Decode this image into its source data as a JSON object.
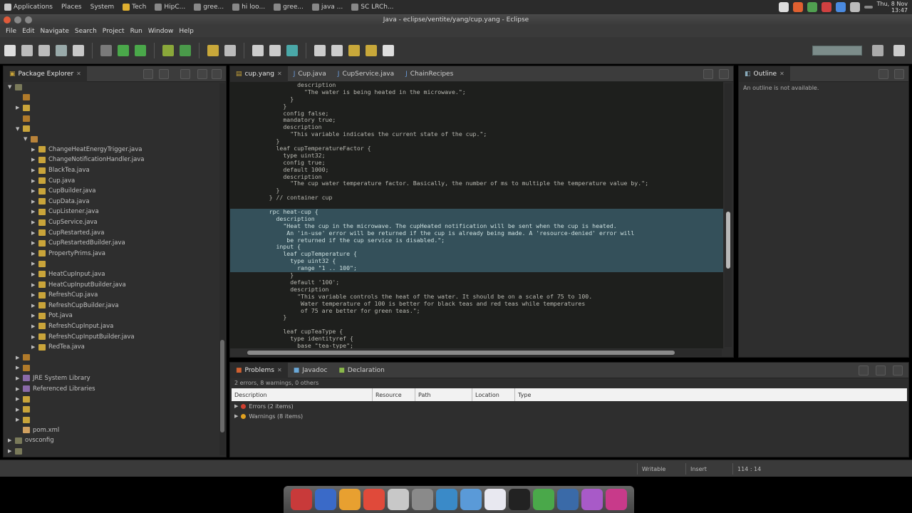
{
  "topbar": {
    "items": [
      {
        "label": "Applications",
        "icon": "app-menu-icon"
      },
      {
        "label": "Places",
        "icon": ""
      },
      {
        "label": "System",
        "icon": ""
      },
      {
        "label": "Tech",
        "icon": "browser-icon"
      },
      {
        "label": "HipC...",
        "icon": "window-icon"
      },
      {
        "label": "gree...",
        "icon": "window-icon"
      },
      {
        "label": "hi loo...",
        "icon": "window-icon"
      },
      {
        "label": "gree...",
        "icon": "window-icon"
      },
      {
        "label": "java ...",
        "icon": "window-icon"
      },
      {
        "label": "SC LRCh...",
        "icon": "window-icon"
      }
    ],
    "clock_day": "Thu, 8 Nov",
    "clock_time": "13:47"
  },
  "window": {
    "title": "Java - eclipse/ventite/yang/cup.yang - Eclipse"
  },
  "menu": [
    "File",
    "Edit",
    "Navigate",
    "Search",
    "Project",
    "Run",
    "Window",
    "Help"
  ],
  "package_explorer": {
    "tab_label": "Package Explorer",
    "rows": [
      {
        "indent": 0,
        "arrow": "▼",
        "label": "",
        "color": "#7a7a5a"
      },
      {
        "indent": 1,
        "arrow": "",
        "label": "",
        "color": "#b07a2a"
      },
      {
        "indent": 1,
        "arrow": "▶",
        "label": "",
        "color": "#c9a43a"
      },
      {
        "indent": 1,
        "arrow": "",
        "label": "",
        "color": "#b07a2a"
      },
      {
        "indent": 1,
        "arrow": "▼",
        "label": "",
        "color": "#c9a43a"
      },
      {
        "indent": 2,
        "arrow": "▼",
        "label": "",
        "color": "#b9833a"
      },
      {
        "indent": 3,
        "arrow": "▶",
        "label": "ChangeHeatEnergyTrigger.java",
        "color": "#c9a43a"
      },
      {
        "indent": 3,
        "arrow": "▶",
        "label": "ChangeNotificationHandler.java",
        "color": "#c9a43a"
      },
      {
        "indent": 3,
        "arrow": "▶",
        "label": "BlackTea.java",
        "color": "#c9a43a"
      },
      {
        "indent": 3,
        "arrow": "▶",
        "label": "Cup.java",
        "color": "#c9a43a"
      },
      {
        "indent": 3,
        "arrow": "▶",
        "label": "CupBuilder.java",
        "color": "#c9a43a"
      },
      {
        "indent": 3,
        "arrow": "▶",
        "label": "CupData.java",
        "color": "#c9a43a"
      },
      {
        "indent": 3,
        "arrow": "▶",
        "label": "CupListener.java",
        "color": "#c9a43a"
      },
      {
        "indent": 3,
        "arrow": "▶",
        "label": "CupService.java",
        "color": "#c9a43a"
      },
      {
        "indent": 3,
        "arrow": "▶",
        "label": "CupRestarted.java",
        "color": "#c9a43a"
      },
      {
        "indent": 3,
        "arrow": "▶",
        "label": "CupRestartedBuilder.java",
        "color": "#c9a43a"
      },
      {
        "indent": 3,
        "arrow": "▶",
        "label": "PropertyPrims.java",
        "color": "#c9a43a"
      },
      {
        "indent": 3,
        "arrow": "▶",
        "label": "",
        "color": "#c9a43a"
      },
      {
        "indent": 3,
        "arrow": "▶",
        "label": "HeatCupInput.java",
        "color": "#c9a43a"
      },
      {
        "indent": 3,
        "arrow": "▶",
        "label": "HeatCupInputBuilder.java",
        "color": "#c9a43a"
      },
      {
        "indent": 3,
        "arrow": "▶",
        "label": "RefreshCup.java",
        "color": "#c9a43a"
      },
      {
        "indent": 3,
        "arrow": "▶",
        "label": "RefreshCupBuilder.java",
        "color": "#c9a43a"
      },
      {
        "indent": 3,
        "arrow": "▶",
        "label": "Pot.java",
        "color": "#c9a43a"
      },
      {
        "indent": 3,
        "arrow": "▶",
        "label": "RefreshCupInput.java",
        "color": "#c9a43a"
      },
      {
        "indent": 3,
        "arrow": "▶",
        "label": "RefreshCupInputBuilder.java",
        "color": "#c9a43a"
      },
      {
        "indent": 3,
        "arrow": "▶",
        "label": "RedTea.java",
        "color": "#c9a43a"
      },
      {
        "indent": 1,
        "arrow": "▶",
        "label": "",
        "color": "#b07a2a"
      },
      {
        "indent": 1,
        "arrow": "▶",
        "label": "",
        "color": "#b07a2a"
      },
      {
        "indent": 1,
        "arrow": "▶",
        "label": "JRE System Library",
        "color": "#8a6aa8"
      },
      {
        "indent": 1,
        "arrow": "▶",
        "label": "Referenced Libraries",
        "color": "#8a6aa8"
      },
      {
        "indent": 1,
        "arrow": "▶",
        "label": "",
        "color": "#c9a43a"
      },
      {
        "indent": 1,
        "arrow": "▶",
        "label": "",
        "color": "#c9a43a"
      },
      {
        "indent": 1,
        "arrow": "▶",
        "label": "",
        "color": "#c9a43a"
      },
      {
        "indent": 1,
        "arrow": "",
        "label": "pom.xml",
        "color": "#d0a060"
      },
      {
        "indent": 0,
        "arrow": "▶",
        "label": "ovsconfig",
        "color": "#7a7a5a"
      },
      {
        "indent": 0,
        "arrow": "▶",
        "label": "",
        "color": "#7a7a5a"
      }
    ]
  },
  "editor": {
    "tabs": [
      {
        "label": "cup.yang",
        "active": true,
        "closable": true
      },
      {
        "label": "Cup.java",
        "active": false,
        "closable": false
      },
      {
        "label": "CupService.java",
        "active": false,
        "closable": false
      },
      {
        "label": "ChainRecipes",
        "active": false,
        "closable": false
      }
    ],
    "lines": [
      {
        "n": "",
        "text": "             description",
        "sel": false
      },
      {
        "n": "",
        "text": "               \"The water is being heated in the microwave.\";",
        "sel": false
      },
      {
        "n": "",
        "text": "           }",
        "sel": false
      },
      {
        "n": "",
        "text": "         }",
        "sel": false
      },
      {
        "n": "",
        "text": "         config false;",
        "sel": false
      },
      {
        "n": "",
        "text": "         mandatory true;",
        "sel": false
      },
      {
        "n": "",
        "text": "         description",
        "sel": false
      },
      {
        "n": "",
        "text": "           \"This variable indicates the current state of the cup.\";",
        "sel": false
      },
      {
        "n": "",
        "text": "       }",
        "sel": false
      },
      {
        "n": "",
        "text": "       leaf cupTemperatureFactor {",
        "sel": false
      },
      {
        "n": "",
        "text": "         type uint32;",
        "sel": false
      },
      {
        "n": "",
        "text": "         config true;",
        "sel": false
      },
      {
        "n": "",
        "text": "         default 1000;",
        "sel": false
      },
      {
        "n": "",
        "text": "         description",
        "sel": false
      },
      {
        "n": "",
        "text": "           \"The cup water temperature factor. Basically, the number of ms to multiple the temperature value by.\";",
        "sel": false
      },
      {
        "n": "",
        "text": "       }",
        "sel": false
      },
      {
        "n": "",
        "text": "     } // container cup",
        "sel": false
      },
      {
        "n": "",
        "text": "",
        "sel": false
      },
      {
        "n": "",
        "text": "     rpc heat-cup {",
        "sel": true
      },
      {
        "n": "",
        "text": "       description",
        "sel": true
      },
      {
        "n": "",
        "text": "         \"Heat the cup in the microwave. The cupHeated notification will be sent when the cup is heated.",
        "sel": true
      },
      {
        "n": "",
        "text": "          An 'in-use' error will be returned if the cup is already being made. A 'resource-denied' error will",
        "sel": true
      },
      {
        "n": "",
        "text": "          be returned if the cup service is disabled.\";",
        "sel": true
      },
      {
        "n": "",
        "text": "       input {",
        "sel": true
      },
      {
        "n": "",
        "text": "         leaf cupTemperature {",
        "sel": true
      },
      {
        "n": "",
        "text": "           type uint32 {",
        "sel": true
      },
      {
        "n": "",
        "text": "             range \"1 .. 100\";",
        "sel": true
      },
      {
        "n": "",
        "text": "           }",
        "sel": false
      },
      {
        "n": "",
        "text": "           default '100';",
        "sel": false
      },
      {
        "n": "",
        "text": "           description",
        "sel": false
      },
      {
        "n": "",
        "text": "             \"This variable controls the heat of the water. It should be on a scale of 75 to 100.",
        "sel": false
      },
      {
        "n": "",
        "text": "              Water temperature of 100 is better for black teas and red teas while temperatures",
        "sel": false
      },
      {
        "n": "",
        "text": "              of 75 are better for green teas.\";",
        "sel": false
      },
      {
        "n": "",
        "text": "         }",
        "sel": false
      },
      {
        "n": "",
        "text": "",
        "sel": false
      },
      {
        "n": "",
        "text": "         leaf cupTeaType {",
        "sel": false
      },
      {
        "n": "",
        "text": "           type identityref {",
        "sel": false
      },
      {
        "n": "",
        "text": "             base \"tea-type\";",
        "sel": false
      }
    ]
  },
  "outline": {
    "tab_label": "Outline",
    "message": "An outline is not available."
  },
  "problems": {
    "tabs": [
      {
        "label": "Problems",
        "active": true
      },
      {
        "label": "Javadoc",
        "active": false
      },
      {
        "label": "Declaration",
        "active": false
      }
    ],
    "summary": "2 errors, 8 warnings, 0 others",
    "columns": [
      "Description",
      "Resource",
      "Path",
      "Location",
      "Type"
    ],
    "rows": [
      {
        "label": "Errors (2 items)",
        "color": "#d04030"
      },
      {
        "label": "Warnings (8 items)",
        "color": "#e0a020"
      }
    ]
  },
  "status": {
    "writable": "Writable",
    "insert": "Insert",
    "position": "114 : 14"
  },
  "dock": {
    "apps": [
      {
        "name": "installer-icon",
        "color": "#c83a3a"
      },
      {
        "name": "files-icon",
        "color": "#3a6ac8"
      },
      {
        "name": "eclipse-icon",
        "color": "#e8a030"
      },
      {
        "name": "chrome-icon",
        "color": "#e04a3a"
      },
      {
        "name": "calculator-icon",
        "color": "#c8c8c8"
      },
      {
        "name": "settings-icon",
        "color": "#8a8a8a"
      },
      {
        "name": "editor-icon",
        "color": "#3a8ac8"
      },
      {
        "name": "network-icon",
        "color": "#5a9ad8"
      },
      {
        "name": "document-icon",
        "color": "#e8e8f0"
      },
      {
        "name": "terminal-icon",
        "color": "#222222"
      },
      {
        "name": "chrome-icon-2",
        "color": "#4aa84a"
      },
      {
        "name": "chat-icon",
        "color": "#3a6aa8"
      },
      {
        "name": "media-icon",
        "color": "#a85ac8"
      },
      {
        "name": "app-icon",
        "color": "#c83a8a"
      }
    ]
  }
}
